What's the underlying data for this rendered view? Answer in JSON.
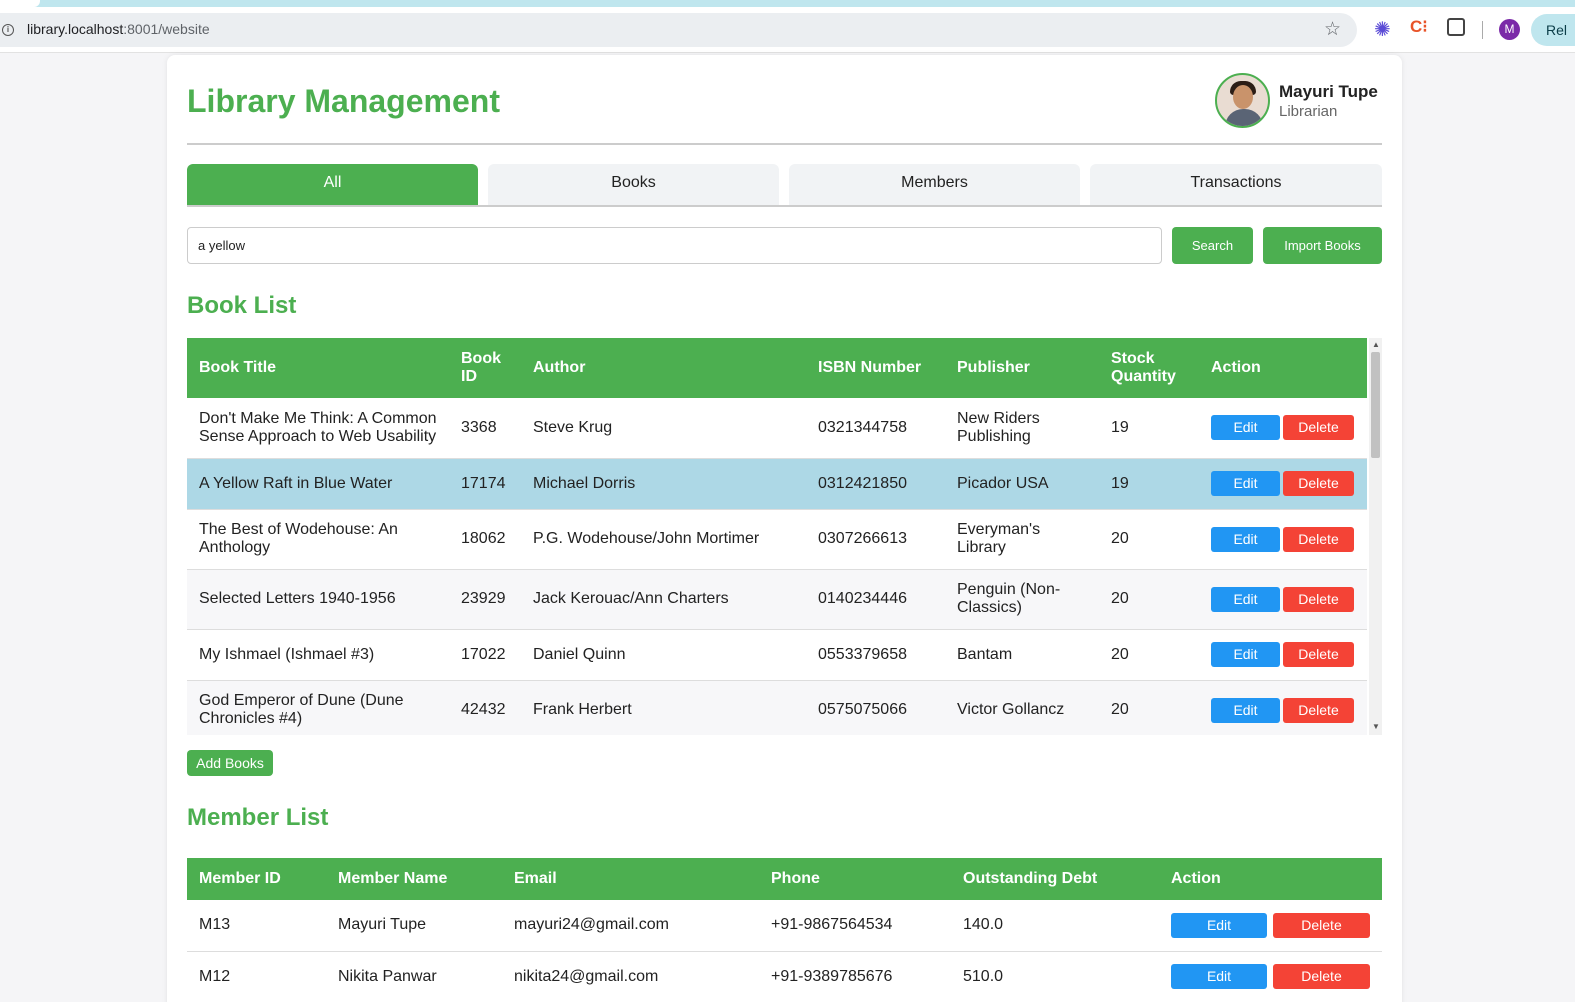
{
  "browser": {
    "url_host": "library.localhost",
    "url_rest": ":8001/website",
    "profile_initial": "M",
    "relaunch_label": "Rel"
  },
  "app": {
    "title": "Library Management",
    "user_name": "Mayuri Tupe",
    "user_role": "Librarian"
  },
  "tabs": [
    "All",
    "Books",
    "Members",
    "Transactions"
  ],
  "active_tab": "All",
  "search": {
    "value": "a yellow",
    "button": "Search",
    "import_button": "Import Books"
  },
  "books": {
    "title": "Book List",
    "columns": [
      "Book Title",
      "Book ID",
      "Author",
      "ISBN Number",
      "Publisher",
      "Stock Quantity",
      "Action"
    ],
    "rows": [
      {
        "title": "Don't Make Me Think: A Common Sense Approach to Web Usability",
        "id": "3368",
        "author": "Steve Krug",
        "isbn": "0321344758",
        "publisher": "New Riders Publishing",
        "stock": "19"
      },
      {
        "title": "A Yellow Raft in Blue Water",
        "id": "17174",
        "author": "Michael Dorris",
        "isbn": "0312421850",
        "publisher": "Picador USA",
        "stock": "19"
      },
      {
        "title": "The Best of Wodehouse: An Anthology",
        "id": "18062",
        "author": "P.G. Wodehouse/John Mortimer",
        "isbn": "0307266613",
        "publisher": "Everyman's Library",
        "stock": "20"
      },
      {
        "title": "Selected Letters 1940-1956",
        "id": "23929",
        "author": "Jack Kerouac/Ann Charters",
        "isbn": "0140234446",
        "publisher": "Penguin (Non-Classics)",
        "stock": "20"
      },
      {
        "title": "My Ishmael (Ishmael #3)",
        "id": "17022",
        "author": "Daniel Quinn",
        "isbn": "0553379658",
        "publisher": "Bantam",
        "stock": "20"
      },
      {
        "title": "God Emperor of Dune (Dune Chronicles #4)",
        "id": "42432",
        "author": "Frank Herbert",
        "isbn": "0575075066",
        "publisher": "Victor Gollancz",
        "stock": "20"
      }
    ],
    "edit_label": "Edit",
    "delete_label": "Delete",
    "add_button": "Add Books"
  },
  "members": {
    "title": "Member List",
    "columns": [
      "Member ID",
      "Member Name",
      "Email",
      "Phone",
      "Outstanding Debt",
      "Action"
    ],
    "rows": [
      {
        "id": "M13",
        "name": "Mayuri Tupe",
        "email": "mayuri24@gmail.com",
        "phone": "+91-9867564534",
        "debt": "140.0"
      },
      {
        "id": "M12",
        "name": "Nikita Panwar",
        "email": "nikita24@gmail.com",
        "phone": "+91-9389785676",
        "debt": "510.0"
      }
    ],
    "edit_label": "Edit",
    "delete_label": "Delete"
  },
  "colors": {
    "primary": "#4caf50",
    "edit": "#2196f3",
    "delete": "#f44336",
    "highlight_row": "#add8e6"
  }
}
